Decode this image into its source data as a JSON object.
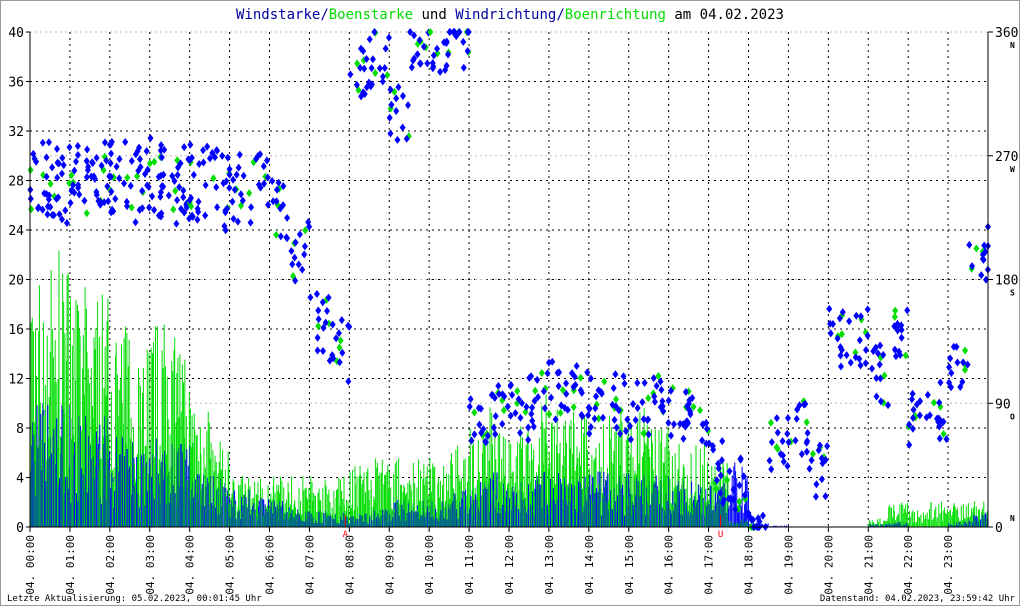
{
  "chart_data": {
    "type": "scatter",
    "title_parts": [
      {
        "text": "Windstarke",
        "color": "#0000a0"
      },
      {
        "text": "/",
        "color": "#0000a0"
      },
      {
        "text": "Boenstarke",
        "color": "#00dd00"
      },
      {
        "text": " und ",
        "color": "#000000"
      },
      {
        "text": "Windrichtung",
        "color": "#0000a0"
      },
      {
        "text": "/",
        "color": "#0000a0"
      },
      {
        "text": "Boenrichtung",
        "color": "#00dd00"
      },
      {
        "text": " am 04.02.2023",
        "color": "#000000"
      }
    ],
    "ylim": [
      0,
      40
    ],
    "y_ticks": [
      "0",
      "4",
      "8",
      "12",
      "16",
      "20",
      "24",
      "28",
      "32",
      "36",
      "40"
    ],
    "y2lim": [
      0,
      360
    ],
    "y2_ticks": [
      {
        "value": "0",
        "dir": "N"
      },
      {
        "value": "90",
        "dir": "O"
      },
      {
        "value": "180",
        "dir": "S"
      },
      {
        "value": "270",
        "dir": "W"
      },
      {
        "value": "360",
        "dir": "N"
      }
    ],
    "x_ticks": [
      "04. 00:00",
      "04. 01:00",
      "04. 02:00",
      "04. 03:00",
      "04. 04:00",
      "04. 05:00",
      "04. 06:00",
      "04. 07:00",
      "04. 08:00",
      "04. 09:00",
      "04. 10:00",
      "04. 11:00",
      "04. 12:00",
      "04. 13:00",
      "04. 14:00",
      "04. 15:00",
      "04. 16:00",
      "04. 17:00",
      "04. 18:00",
      "04. 19:00",
      "04. 20:00",
      "04. 21:00",
      "04. 22:00",
      "04. 23:00"
    ],
    "markers": [
      {
        "label": "A",
        "hour": 7.9
      },
      {
        "label": "U",
        "hour": 17.3
      }
    ],
    "x_hours_halfhourly": [
      0,
      0.5,
      1,
      1.5,
      2,
      2.5,
      3,
      3.5,
      4,
      4.5,
      5,
      5.5,
      6,
      6.5,
      7,
      7.5,
      8,
      8.5,
      9,
      9.5,
      10,
      10.5,
      11,
      11.5,
      12,
      12.5,
      13,
      13.5,
      14,
      14.5,
      15,
      15.5,
      16,
      16.5,
      17,
      17.5,
      18,
      18.5,
      19,
      19.5,
      20,
      20.5,
      21,
      21.5,
      22,
      22.5,
      23,
      23.5
    ],
    "series": [
      {
        "name": "Windstarke",
        "color": "#0000ff",
        "values": [
          7,
          7,
          6,
          6,
          5,
          5,
          5,
          5,
          4,
          3,
          2,
          2,
          1.5,
          1,
          1,
          0.8,
          0.8,
          1,
          1.5,
          1.5,
          1.5,
          2,
          2.5,
          3,
          2.5,
          3,
          3,
          3,
          3,
          3,
          3,
          3,
          2.5,
          2.5,
          2.5,
          3.5,
          0.2,
          0.1,
          0,
          0,
          0,
          0,
          0.2,
          0.3,
          0,
          0,
          0.3,
          0.8
        ]
      },
      {
        "name": "Boenstarke",
        "color": "#00dd00",
        "values": [
          15,
          16,
          14,
          14,
          12,
          12,
          12,
          11,
          8,
          5,
          3,
          3,
          3,
          3,
          3,
          3,
          4,
          4,
          4,
          4,
          4,
          5,
          6,
          7,
          6,
          8,
          7,
          7,
          6,
          7,
          7,
          6,
          5,
          5,
          4,
          0.5,
          0,
          0,
          0,
          0,
          0,
          0,
          0.5,
          1.5,
          1,
          1.5,
          1.5,
          1.5
        ]
      },
      {
        "name": "Windrichtung",
        "color": "#0000ff",
        "unit": "deg",
        "values": [
          252,
          250,
          250,
          250,
          255,
          250,
          255,
          250,
          250,
          245,
          250,
          250,
          230,
          200,
          150,
          128,
          330,
          340,
          300,
          345,
          350,
          352,
          80,
          90,
          85,
          90,
          100,
          95,
          90,
          90,
          85,
          90,
          85,
          80,
          40,
          30,
          5,
          63,
          75,
          42,
          137,
          137,
          110,
          144,
          75,
          85,
          117,
          200
        ]
      },
      {
        "name": "Boenrichtung",
        "color": "#00dd00",
        "unit": "deg",
        "values": [
          250,
          250,
          248,
          252,
          255,
          250,
          252,
          250,
          248,
          245,
          250,
          250,
          232,
          200,
          150,
          130,
          335,
          340,
          300,
          345,
          350,
          350,
          85,
          90,
          88,
          92,
          100,
          95,
          90,
          90,
          88,
          90,
          85,
          80,
          40,
          30,
          5,
          65,
          75,
          42,
          137,
          137,
          110,
          144,
          78,
          85,
          117,
          195
        ]
      }
    ]
  },
  "footer": {
    "left": "Letzte Aktualisierung: 05.02.2023, 00:01:45 Uhr",
    "right": "Datenstand: 04.02.2023, 23:59:42 Uhr"
  }
}
